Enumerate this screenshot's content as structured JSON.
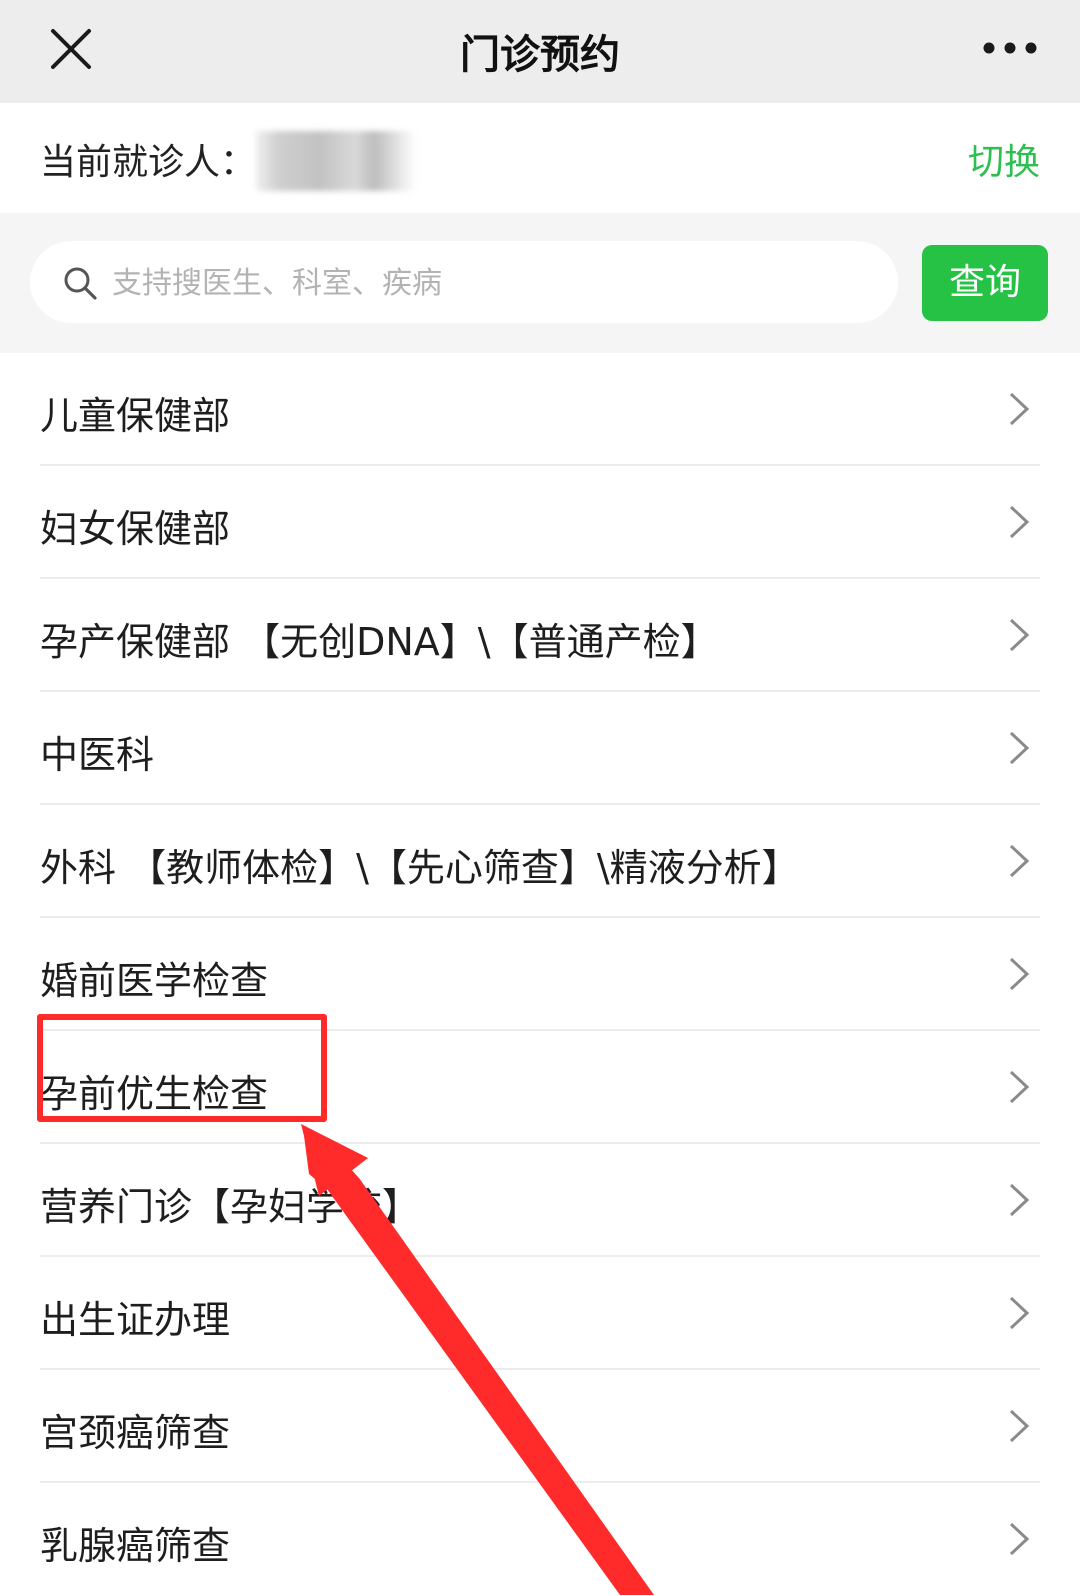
{
  "nav": {
    "title": "门诊预约",
    "close_icon": "close-icon",
    "more_icon": "more-dots-icon"
  },
  "patient": {
    "label": "当前就诊人：",
    "switch_label": "切换"
  },
  "search": {
    "placeholder": "支持搜医生、科室、疾病",
    "value": "",
    "button_label": "查询",
    "icon": "search-icon"
  },
  "departments": [
    {
      "name": "儿童保健部"
    },
    {
      "name": "妇女保健部"
    },
    {
      "name": "孕产保健部 【无创DNA】\\【普通产检】"
    },
    {
      "name": "中医科"
    },
    {
      "name": "外科 【教师体检】\\【先心筛查】\\精液分析】"
    },
    {
      "name": "婚前医学检查"
    },
    {
      "name": "孕前优生检查"
    },
    {
      "name": "营养门诊【孕妇学校】"
    },
    {
      "name": "出生证办理"
    },
    {
      "name": "宫颈癌筛查"
    },
    {
      "name": "乳腺癌筛查"
    }
  ],
  "colors": {
    "accent_green": "#25c246",
    "switch_green": "#2fbf50",
    "annotation_red": "#ff2a2a",
    "nav_bg": "#ededed"
  }
}
